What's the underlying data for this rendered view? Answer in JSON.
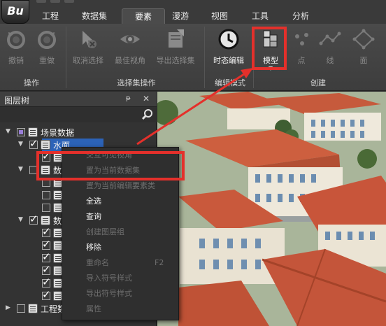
{
  "app": {
    "logo": "Bu"
  },
  "tabs": [
    {
      "label": "工程",
      "active": false
    },
    {
      "label": "数据集",
      "active": false
    },
    {
      "label": "要素",
      "active": true
    },
    {
      "label": "漫游",
      "active": false
    },
    {
      "label": "视图",
      "active": false
    },
    {
      "label": "工具",
      "active": false
    },
    {
      "label": "分析",
      "active": false
    }
  ],
  "ribbon": {
    "undo": "撤销",
    "redo": "重做",
    "cancel_select": "取消选择",
    "best_view": "最佳视角",
    "export_selection": "导出选择集",
    "timeline_edit": "时态编辑",
    "model": "模型",
    "point": "点",
    "line": "线",
    "face": "面",
    "groups": {
      "operation": "操作",
      "selection_ops": "选择集操作",
      "edit_mode": "编辑模式",
      "create": "创建"
    }
  },
  "panel": {
    "title": "图层树",
    "pin": "ᵽ",
    "close": "✕"
  },
  "tree": {
    "root": "场景数据",
    "water": "水面",
    "data1": "数",
    "data2": "数",
    "project": "工程数"
  },
  "context_menu": {
    "items": [
      {
        "label": "交互可见视角",
        "enabled": false
      },
      {
        "label": "置为当前数据集",
        "enabled": false
      },
      {
        "label": "置为当前编辑要素类",
        "enabled": false
      },
      {
        "label": "全选",
        "enabled": true
      },
      {
        "label": "查询",
        "enabled": true
      },
      {
        "label": "创建图层组",
        "enabled": false
      },
      {
        "label": "移除",
        "enabled": true
      },
      {
        "label": "重命名",
        "enabled": false,
        "shortcut": "F2"
      },
      {
        "label": "导入符号样式",
        "enabled": false
      },
      {
        "label": "导出符号样式",
        "enabled": false
      },
      {
        "label": "属性",
        "enabled": false
      }
    ]
  },
  "colors": {
    "annotation": "#e4302b",
    "selection": "#2c63b8",
    "roof": "#c8573a",
    "wall": "#ece6d6"
  }
}
